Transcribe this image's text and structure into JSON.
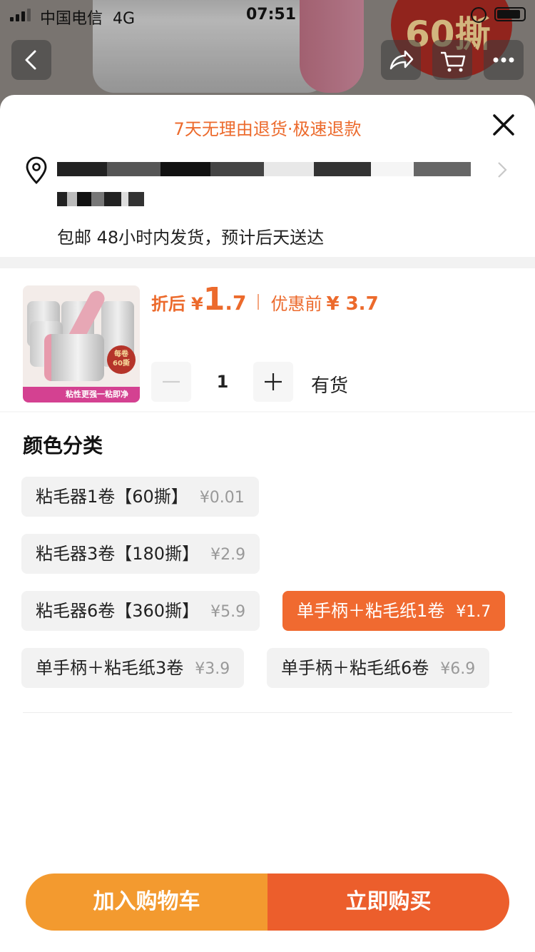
{
  "status_bar": {
    "carrier": "中国电信",
    "network": "4G",
    "time": "07:51"
  },
  "background": {
    "badge_text": "60撕"
  },
  "sheet": {
    "return_banner": "7天无理由退货·极速退款",
    "shipping_info": "包邮 48小时内发货，预计后天送达",
    "product": {
      "thumb_badge": "每卷\n60撕",
      "thumb_strip": "粘性更强一粘即净",
      "price_label": "折后",
      "currency": "¥",
      "price_int": "1",
      "price_dec": ".7",
      "orig_label": "优惠前",
      "orig_price": "¥ 3.7",
      "quantity": "1",
      "stock": "有货"
    },
    "section_title": "颜色分类",
    "options": [
      {
        "label": "粘毛器1卷【60撕】",
        "price": "¥0.01",
        "selected": false
      },
      {
        "label": "粘毛器3卷【180撕】",
        "price": "¥2.9",
        "selected": false
      },
      {
        "label": "粘毛器6卷【360撕】",
        "price": "¥5.9",
        "selected": false
      },
      {
        "label": "单手柄＋粘毛纸1卷",
        "price": "¥1.7",
        "selected": true
      },
      {
        "label": "单手柄＋粘毛纸3卷",
        "price": "¥3.9",
        "selected": false
      },
      {
        "label": "单手柄＋粘毛纸6卷",
        "price": "¥6.9",
        "selected": false
      }
    ],
    "actions": {
      "add_to_cart": "加入购物车",
      "buy_now": "立即购买"
    }
  },
  "colors": {
    "accent": "#ec6a2c",
    "cart": "#f39a2f",
    "buy": "#ec5e2c"
  }
}
